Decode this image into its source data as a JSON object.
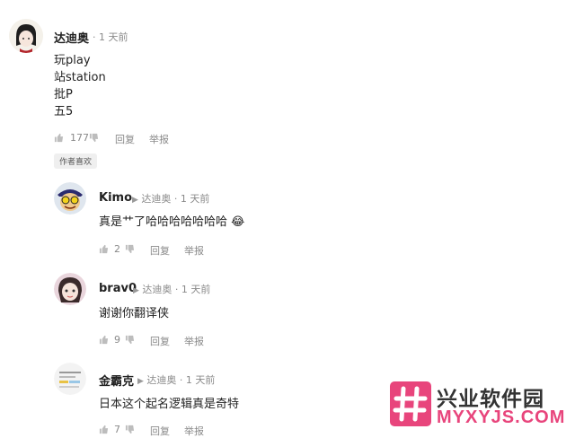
{
  "comments": [
    {
      "user": "达迪奥",
      "time": "1 天前",
      "lines": [
        "玩play",
        "站station",
        "批P",
        "五5"
      ],
      "likes": "177",
      "reply": "回复",
      "report": "举报",
      "badge": "作者喜欢"
    },
    {
      "user": "Kimo",
      "reply_to": "达迪奥",
      "time": "1 天前",
      "text": "真是艹了哈哈哈哈哈哈哈",
      "emoji": "😂",
      "likes": "2",
      "reply": "回复",
      "report": "举报"
    },
    {
      "user": "brav0",
      "reply_to": "达迪奥",
      "time": "1 天前",
      "text": "谢谢你翻译侠",
      "likes": "9",
      "reply": "回复",
      "report": "举报"
    },
    {
      "user": "金霸克",
      "reply_to": "达迪奥",
      "time": "1 天前",
      "text": "日本这个起名逻辑真是奇特",
      "likes": "7",
      "reply": "回复",
      "report": "举报"
    }
  ],
  "watermark": {
    "name": "兴业软件园",
    "url": "MYXYJS.COM"
  },
  "colors": {
    "meta": "#8a8a8a",
    "brand_pink": "#e8457c",
    "brand_text": "#333333"
  }
}
